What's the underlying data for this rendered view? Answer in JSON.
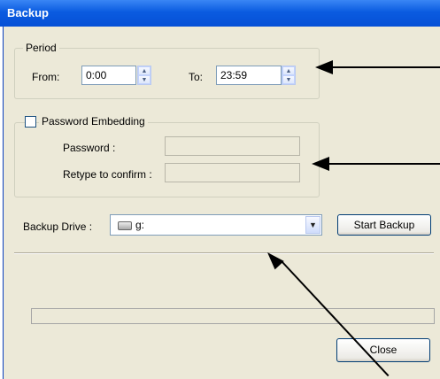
{
  "window": {
    "title": "Backup"
  },
  "period": {
    "group_label": "Period",
    "from_label": "From:",
    "from_value": "0:00",
    "to_label": "To:",
    "to_value": "23:59"
  },
  "password": {
    "group_label": "Password Embedding",
    "checked": false,
    "password_label": "Password :",
    "retype_label": "Retype to confirm :",
    "password_value": "",
    "retype_value": ""
  },
  "backup": {
    "drive_label": "Backup Drive :",
    "drive_value": "g:",
    "drive_icon": "drive-icon",
    "start_button": "Start Backup"
  },
  "footer": {
    "close_button": "Close"
  },
  "annotations": {
    "arrow_color": "#000000"
  }
}
